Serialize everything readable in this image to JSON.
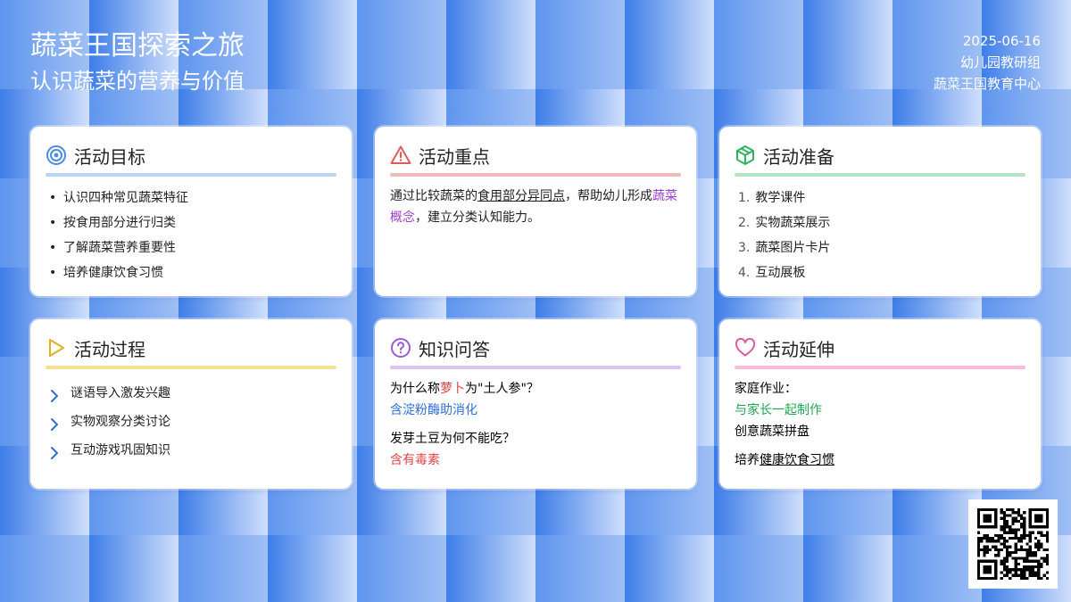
{
  "header": {
    "title": "蔬菜王国探索之旅",
    "subtitle": "认识蔬菜的营养与价值",
    "date": "2025-06-16",
    "org": "幼儿园教研组",
    "center": "蔬菜王国教育中心"
  },
  "colors": {
    "goal": "#4a8be0",
    "focus": "#e05a5a",
    "prep": "#2fb35f",
    "process": "#e0b020",
    "quiz": "#9b59d6",
    "ext": "#e05aa0"
  },
  "cards": {
    "goal": {
      "icon": "target-icon",
      "title": "活动目标",
      "items": [
        "认识四种常见蔬菜特征",
        "按食用部分进行归类",
        "了解蔬菜营养重要性",
        "培养健康饮食习惯"
      ]
    },
    "focus": {
      "icon": "warning-triangle-icon",
      "title": "活动重点",
      "p1": "通过比较蔬菜的",
      "p2": "食用部分异同点",
      "p3": "，帮助幼儿形成",
      "p4": "蔬菜概念",
      "p5": "，建立分类认知能力。"
    },
    "prep": {
      "icon": "box-icon",
      "title": "活动准备",
      "items": [
        {
          "n": "1.",
          "t": "教学课件"
        },
        {
          "n": "2.",
          "t": "实物蔬菜展示"
        },
        {
          "n": "3.",
          "t": "蔬菜图片卡片"
        },
        {
          "n": "4.",
          "t": "互动展板"
        }
      ]
    },
    "process": {
      "icon": "play-triangle-icon",
      "title": "活动过程",
      "items": [
        "谜语导入激发兴趣",
        "实物观察分类讨论",
        "互动游戏巩固知识"
      ]
    },
    "quiz": {
      "icon": "question-circle-icon",
      "title": "知识问答",
      "q1a": "为什么称",
      "q1b": "萝卜",
      "q1c": "为\"土人参\"？",
      "a1": "含淀粉酶助消化",
      "q2": "发芽土豆为何不能吃？",
      "a2": "含有毒素"
    },
    "ext": {
      "icon": "heart-icon",
      "title": "活动延伸",
      "l1": "家庭作业：",
      "l2": "与家长一起制作",
      "l3": "创意蔬菜拼盘",
      "l4a": "培养",
      "l4b": "健康饮食习惯"
    }
  },
  "qr": {
    "icon": "qr-code-icon"
  }
}
